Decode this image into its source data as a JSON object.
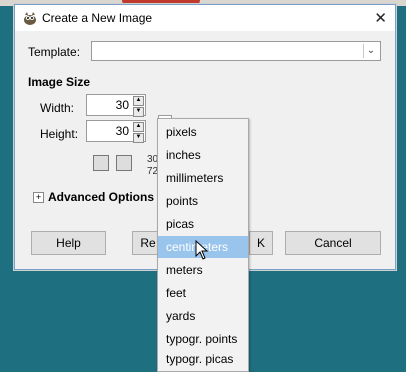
{
  "dialog": {
    "title": "Create a New Image",
    "close_glyph": "✕",
    "template_label": "Template:",
    "template_value": "",
    "image_size_label": "Image Size",
    "width_label": "Width:",
    "width_value": "30",
    "height_label": "Height:",
    "height_value": "30",
    "info_line1": "30",
    "info_line2": "72",
    "advanced_label": "Advanced Options",
    "advanced_toggle": "+"
  },
  "buttons": {
    "help": "Help",
    "reset": "Re",
    "ok": "K",
    "cancel": "Cancel"
  },
  "unit_menu": {
    "items": [
      "pixels",
      "inches",
      "millimeters",
      "points",
      "picas",
      "centimeters",
      "meters",
      "feet",
      "yards",
      "typogr. points",
      "typogr. picas"
    ],
    "selected": "centimeters"
  },
  "icons": {
    "app": "gimp-wilber-icon",
    "portrait": "portrait-icon",
    "landscape": "landscape-icon",
    "chevron": "chevron-down-icon",
    "cursor": "mouse-pointer-icon"
  }
}
